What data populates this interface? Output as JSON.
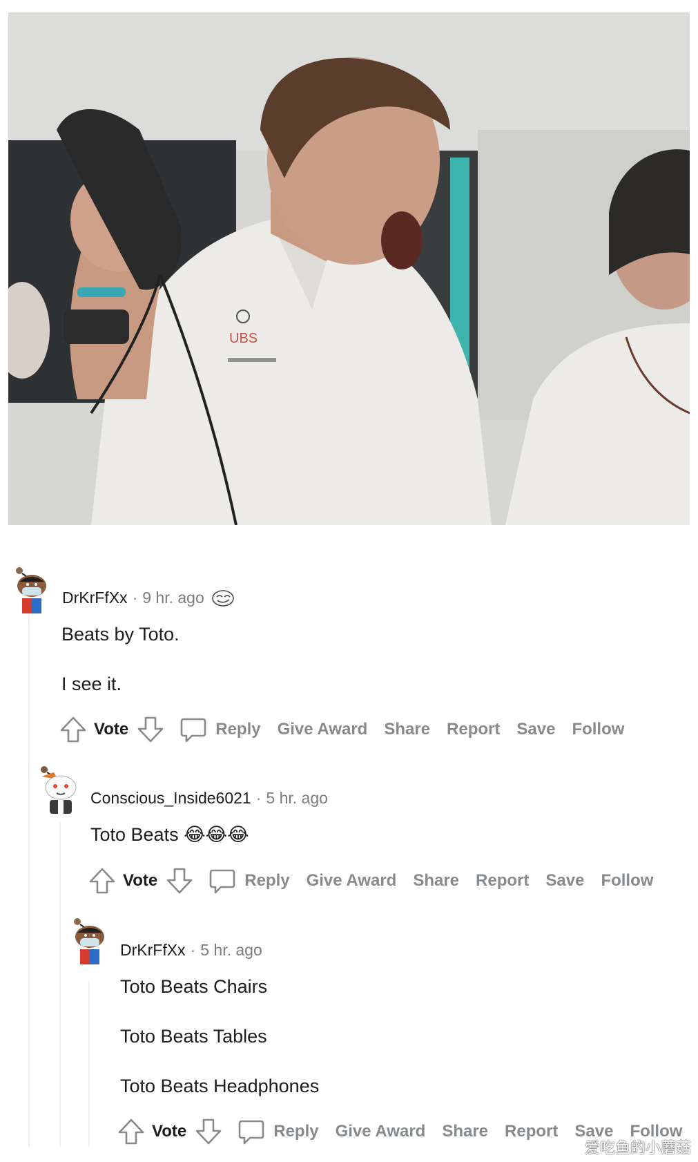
{
  "comments": [
    {
      "author": "DrKrFfXx",
      "separator": "·",
      "time": "9 hr. ago",
      "has_flair": true,
      "body": [
        "Beats by Toto.",
        "I see it."
      ],
      "actions": {
        "vote": "Vote",
        "reply": "Reply",
        "give_award": "Give Award",
        "share": "Share",
        "report": "Report",
        "save": "Save",
        "follow": "Follow"
      }
    },
    {
      "author": "Conscious_Inside6021",
      "separator": "·",
      "time": "5 hr. ago",
      "has_flair": false,
      "body": [
        "Toto Beats 😂😂😂"
      ],
      "actions": {
        "vote": "Vote",
        "reply": "Reply",
        "give_award": "Give Award",
        "share": "Share",
        "report": "Report",
        "save": "Save",
        "follow": "Follow"
      }
    },
    {
      "author": "DrKrFfXx",
      "separator": "·",
      "time": "5 hr. ago",
      "has_flair": false,
      "body": [
        "Toto Beats Chairs",
        "Toto Beats Tables",
        "Toto Beats Headphones"
      ],
      "actions": {
        "vote": "Vote",
        "reply": "Reply",
        "give_award": "Give Award",
        "share": "Share",
        "report": "Report",
        "save": "Save",
        "follow": "Follow"
      }
    }
  ],
  "watermark": "爱吃鱼的小蘑菇",
  "colors": {
    "muted": "#878a8c",
    "text": "#1c1c1c",
    "thread_line": "#edeff1"
  }
}
